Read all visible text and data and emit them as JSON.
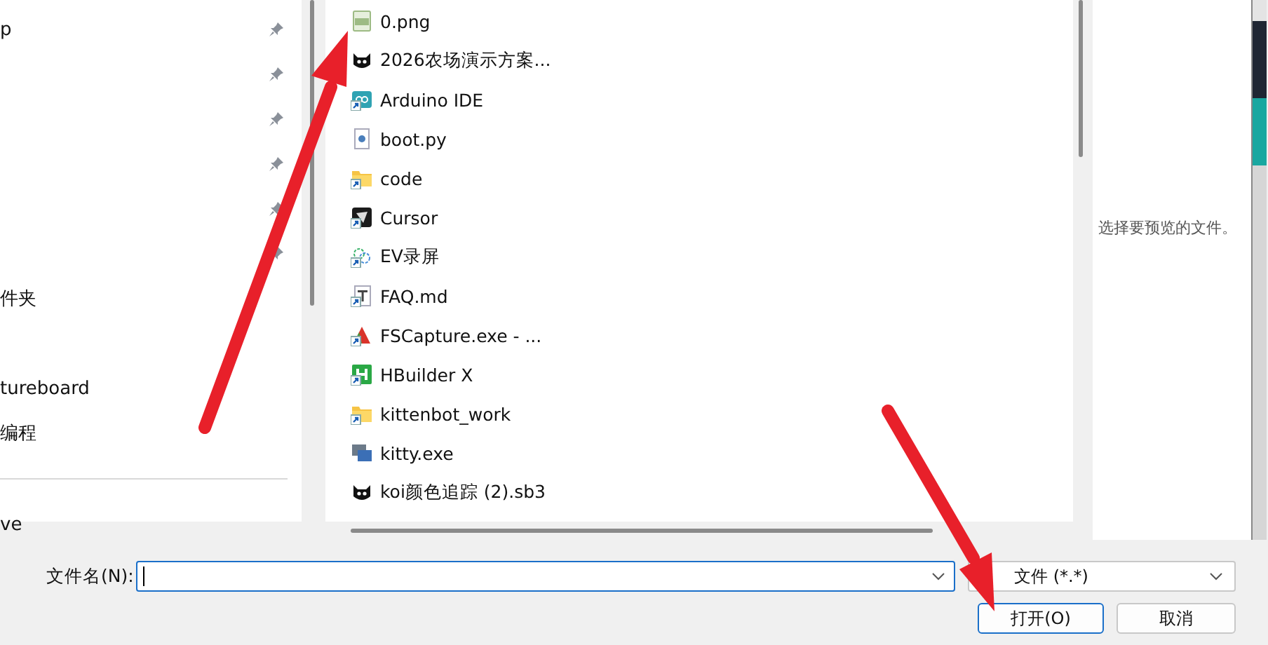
{
  "nav_pane": {
    "items": [
      {
        "label": "p",
        "pinned": true
      },
      {
        "pinned": true
      },
      {
        "pinned": true
      },
      {
        "pinned": true
      },
      {
        "pinned": true
      },
      {
        "pinned": true
      },
      {
        "label": "件夹",
        "pinned": false
      },
      {
        "pinned": false
      },
      {
        "label": "tureboard",
        "pinned": false
      },
      {
        "label": "编程",
        "pinned": false
      },
      {
        "kind": "divider"
      },
      {
        "label": "ve",
        "pinned": false
      }
    ]
  },
  "file_list": {
    "items": [
      {
        "name": "0.png",
        "kind": "png",
        "shortcut": false
      },
      {
        "name": "2026农场演示方案...",
        "kind": "cat",
        "shortcut": false
      },
      {
        "name": "Arduino IDE",
        "kind": "arduino",
        "shortcut": true
      },
      {
        "name": "boot.py",
        "kind": "python",
        "shortcut": false
      },
      {
        "name": "code",
        "kind": "folder",
        "shortcut": true
      },
      {
        "name": "Cursor",
        "kind": "cursor",
        "shortcut": true
      },
      {
        "name": "EV录屏",
        "kind": "ev",
        "shortcut": true
      },
      {
        "name": "FAQ.md",
        "kind": "text",
        "shortcut": true
      },
      {
        "name": "FSCapture.exe - ...",
        "kind": "fscapture",
        "shortcut": true
      },
      {
        "name": "HBuilder X",
        "kind": "hbuilder",
        "shortcut": true
      },
      {
        "name": "kittenbot_work",
        "kind": "folder",
        "shortcut": true
      },
      {
        "name": "kitty.exe",
        "kind": "monitor",
        "shortcut": false
      },
      {
        "name": "koi颜色追踪 (2).sb3",
        "kind": "cat",
        "shortcut": false
      }
    ]
  },
  "preview_pane": {
    "message": "选择要预览的文件。"
  },
  "footer": {
    "filename_label": "文件名(N):",
    "file_type": "文件 (*.*)",
    "buttons": [
      {
        "label": "打开(O)",
        "kind": "primary"
      },
      {
        "label": "取消",
        "kind": "normal"
      }
    ]
  }
}
